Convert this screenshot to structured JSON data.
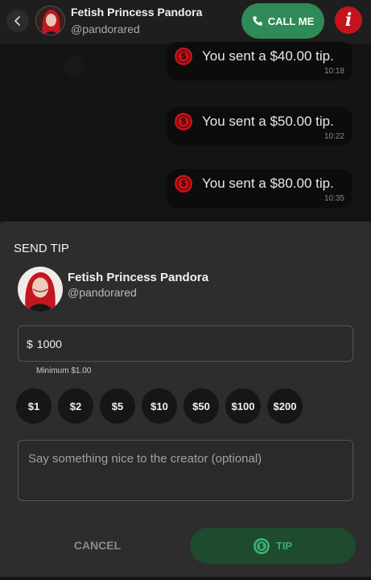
{
  "header": {
    "back_icon": "chevron-left-icon",
    "name": "Fetish Princess Pandora",
    "handle": "@pandorared",
    "call_label": "CALL ME",
    "call_icon": "phone-icon",
    "info_icon": "info-icon",
    "info_glyph": "i"
  },
  "messages": [
    {
      "text": "You sent a $40.00 tip.",
      "time": "10:18",
      "icon": "dollar-icon",
      "glyph": "$"
    },
    {
      "text": "You sent a $50.00 tip.",
      "time": "10:22",
      "icon": "dollar-icon",
      "glyph": "$"
    },
    {
      "text": "You sent a $80.00 tip.",
      "time": "10:35",
      "icon": "dollar-icon",
      "glyph": "$"
    }
  ],
  "tip_modal": {
    "title": "SEND TIP",
    "creator_name": "Fetish Princess Pandora",
    "creator_handle": "@pandorared",
    "currency_symbol": "$",
    "amount_value": "1000",
    "minimum_note": "Minimum $1.00",
    "presets": [
      "$1",
      "$2",
      "$5",
      "$10",
      "$50",
      "$100",
      "$200"
    ],
    "message_placeholder": "Say something nice to the creator (optional)",
    "cancel_label": "CANCEL",
    "tip_label": "TIP",
    "tip_icon": "dollar-coin-icon",
    "tip_glyph": "$"
  },
  "colors": {
    "accent_green": "#2e8b57",
    "accent_red": "#c3141b",
    "tip_button_bg": "#1e4a2d",
    "tip_button_text": "#3bb06a"
  }
}
